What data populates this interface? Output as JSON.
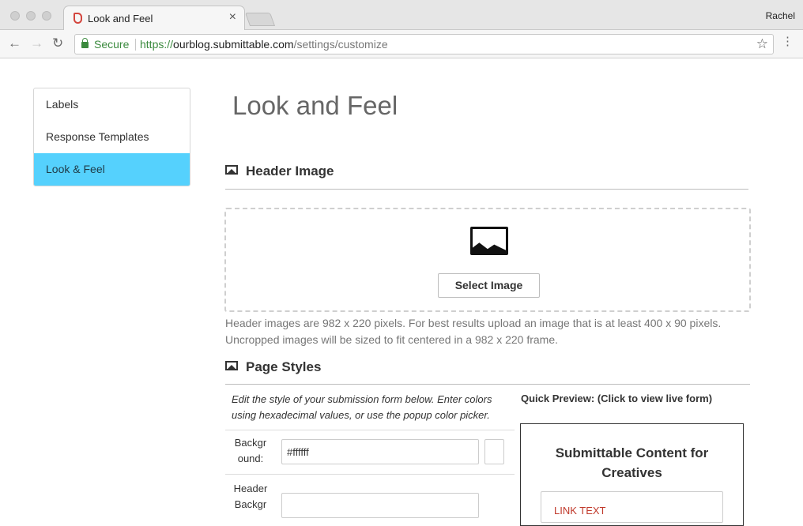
{
  "browser": {
    "tab_title": "Look and Feel",
    "profile_name": "Rachel",
    "secure_label": "Secure",
    "url_protocol": "https://",
    "url_host": "ourblog.submittable.com",
    "url_path": "/settings/customize"
  },
  "sidebar": {
    "items": [
      {
        "label": "Labels",
        "active": false
      },
      {
        "label": "Response Templates",
        "active": false
      },
      {
        "label": "Look & Feel",
        "active": true
      }
    ],
    "active_color": "#55d1fd"
  },
  "main": {
    "title": "Look and Feel",
    "header_image": {
      "heading": "Header Image",
      "select_button": "Select Image",
      "help_line1": "Header images are 982 x 220 pixels. For best results upload an image that is at least 400 x 90 pixels.",
      "help_line2": "Uncropped images will be sized to fit centered in a 982 x 220 frame."
    },
    "page_styles": {
      "heading": "Page Styles",
      "instructions": "Edit the style of your submission form below. Enter colors using hexadecimal values, or use the popup color picker.",
      "rows": [
        {
          "label_part1": "Backgr",
          "label_part2": "ound:",
          "value": "#ffffff"
        },
        {
          "label_part1": "Header",
          "label_part2": "Backgr",
          "value": ""
        }
      ]
    },
    "preview": {
      "label": "Quick Preview: (Click to view live form)",
      "title": "Submittable Content for Creatives",
      "link_text": "LINK TEXT"
    }
  }
}
